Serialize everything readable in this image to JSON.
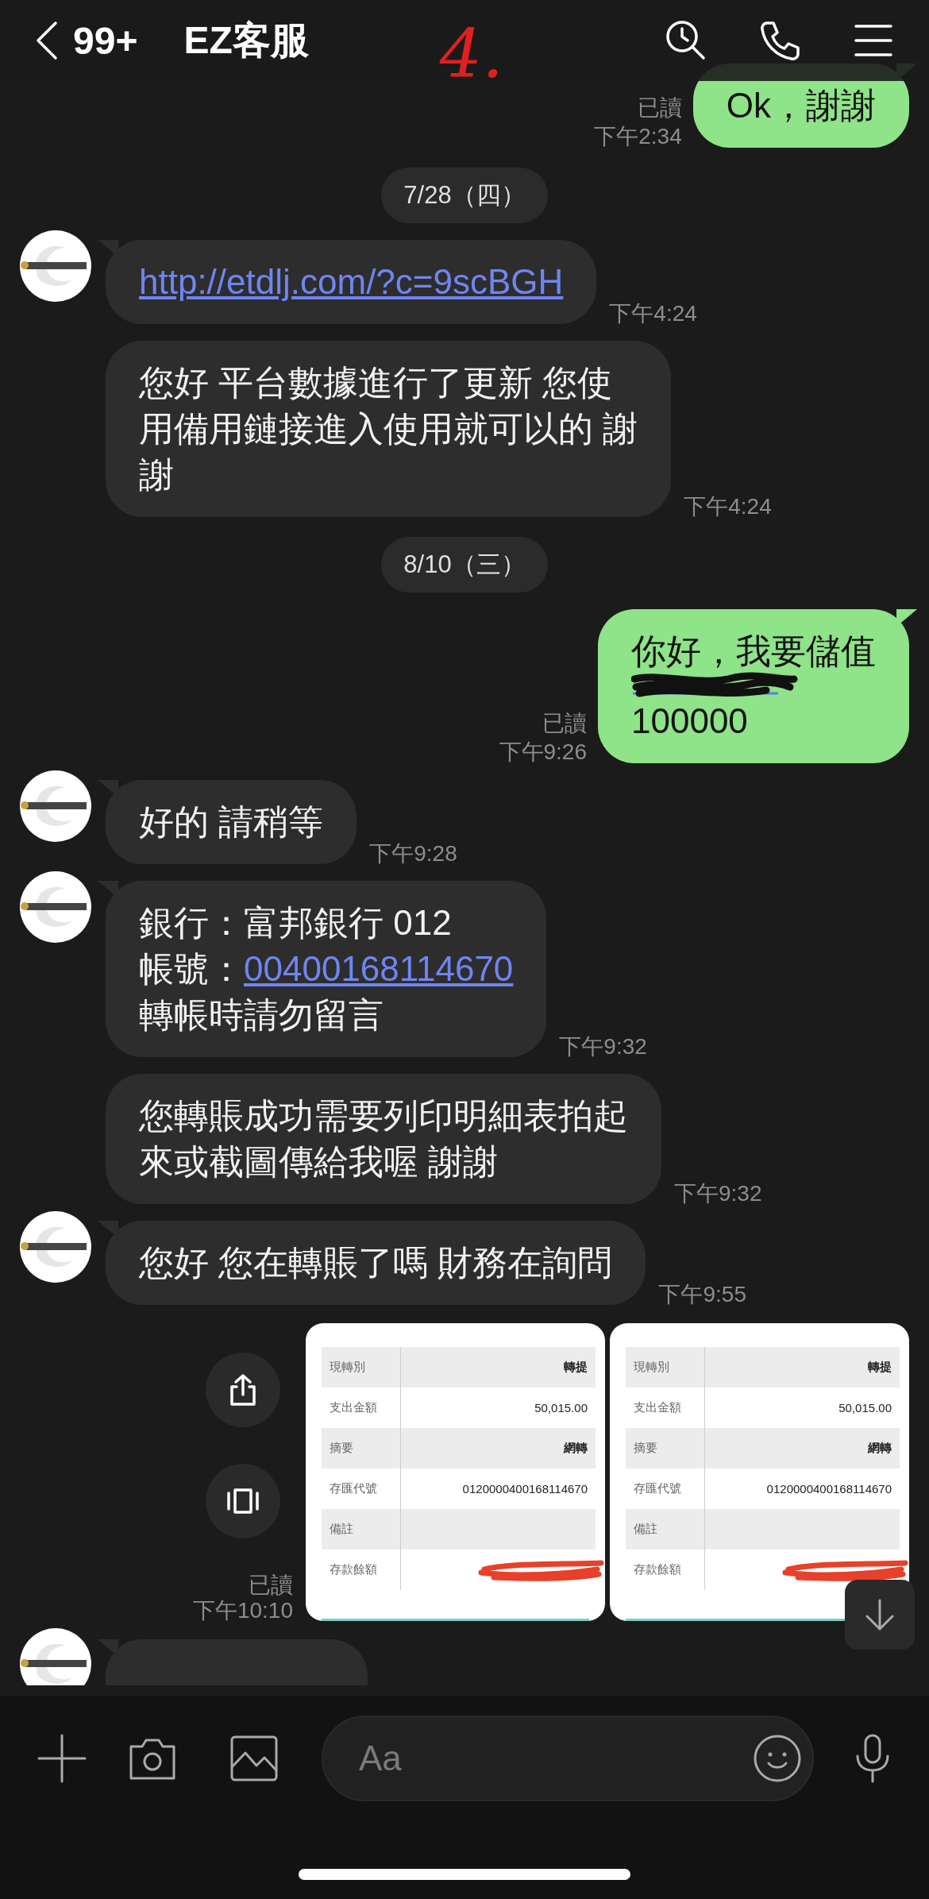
{
  "header": {
    "unread_count": "99+",
    "title": "EZ客服"
  },
  "annotation": "4.",
  "messages": [
    {
      "kind": "outgoing",
      "lines": [
        {
          "kind": "text",
          "text": "Ok，謝謝"
        }
      ],
      "read": "已讀",
      "time": "下午2:34"
    },
    {
      "kind": "date",
      "text": "7/28（四）"
    },
    {
      "kind": "incoming",
      "avatar": true,
      "lines": [
        {
          "kind": "link",
          "text": "http://etdlj.com/?c=9scBGH"
        }
      ],
      "time": "下午4:24"
    },
    {
      "kind": "incoming",
      "avatar": false,
      "lines": [
        {
          "kind": "text",
          "text": "您好 平台數據進行了更新 您使"
        },
        {
          "kind": "text",
          "text": "用備用鏈接進入使用就可以的 謝"
        },
        {
          "kind": "text",
          "text": "謝"
        }
      ],
      "time": "下午4:24"
    },
    {
      "kind": "date",
      "text": "8/10（三）"
    },
    {
      "kind": "outgoing",
      "lines": [
        {
          "kind": "text",
          "text": "你好，我要儲值"
        },
        {
          "kind": "scribble"
        },
        {
          "kind": "text",
          "text": "100000"
        }
      ],
      "read": "已讀",
      "time": "下午9:26"
    },
    {
      "kind": "incoming",
      "avatar": true,
      "lines": [
        {
          "kind": "text",
          "text": "好的 請稍等"
        }
      ],
      "time": "下午9:28"
    },
    {
      "kind": "incoming",
      "avatar": true,
      "lines": [
        {
          "kind": "text",
          "text": "銀行：富邦銀行 012"
        },
        {
          "kind": "labeled_link",
          "label": "帳號：",
          "text": "00400168114670"
        },
        {
          "kind": "text",
          "text": "轉帳時請勿留言"
        }
      ],
      "time": "下午9:32"
    },
    {
      "kind": "incoming",
      "avatar": false,
      "lines": [
        {
          "kind": "text",
          "text": "您轉賬成功需要列印明細表拍起"
        },
        {
          "kind": "text",
          "text": "來或截圖傳給我喔 謝謝"
        }
      ],
      "time": "下午9:32"
    },
    {
      "kind": "incoming",
      "avatar": true,
      "lines": [
        {
          "kind": "text",
          "text": "您好 您在轉賬了嗎 財務在詢問"
        }
      ],
      "time": "下午9:55"
    },
    {
      "kind": "images",
      "read": "已讀",
      "time": "下午10:10",
      "images": [
        {
          "rows": [
            {
              "label": "現轉別",
              "value": "轉提",
              "strong": true
            },
            {
              "label": "支出金額",
              "value": "50,015.00"
            },
            {
              "label": "摘要",
              "value": "網轉",
              "strong": true
            },
            {
              "label": "存匯代號",
              "value": "0120000400168114670"
            },
            {
              "label": "備註"
            },
            {
              "label": "存款餘額",
              "redacted": true
            }
          ]
        },
        {
          "rows": [
            {
              "label": "現轉別",
              "value": "轉提",
              "strong": true
            },
            {
              "label": "支出金額",
              "value": "50,015.00"
            },
            {
              "label": "摘要",
              "value": "網轉",
              "strong": true
            },
            {
              "label": "存匯代號",
              "value": "0120000400168114670"
            },
            {
              "label": "備註"
            },
            {
              "label": "存款餘額",
              "redacted": true
            }
          ]
        }
      ]
    },
    {
      "kind": "partial_incoming"
    }
  ],
  "composer": {
    "placeholder": "Aa"
  }
}
